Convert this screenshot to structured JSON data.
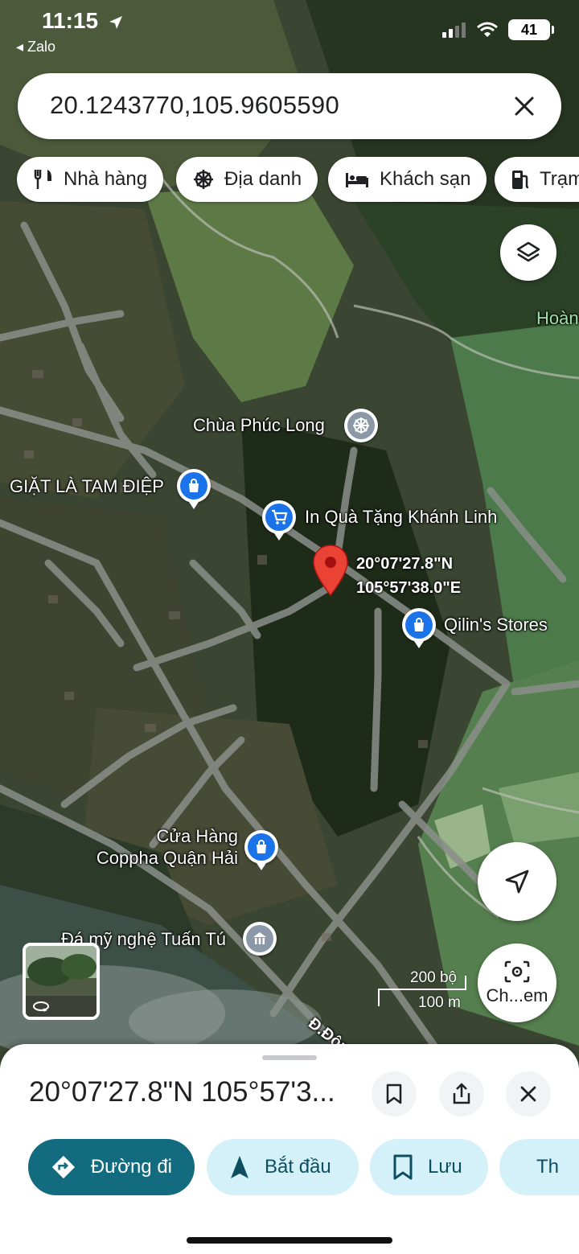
{
  "status_bar": {
    "time": "11:15",
    "back_app": "◂ Zalo",
    "battery": "41"
  },
  "search": {
    "value": "20.1243770,105.9605590"
  },
  "chips": [
    {
      "label": "Nhà hàng",
      "icon": "restaurant-icon"
    },
    {
      "label": "Địa danh",
      "icon": "landmark-icon"
    },
    {
      "label": "Khách sạn",
      "icon": "hotel-icon"
    },
    {
      "label": "Trạm",
      "icon": "gas-station-icon"
    }
  ],
  "map": {
    "area_label": "Hoàn",
    "street_label": "Đ.Đôn",
    "pin_coords_lat": "20°07'27.8\"N",
    "pin_coords_lng": "105°57'38.0\"E",
    "pois": [
      {
        "label": "Chùa Phúc Long",
        "icon": "temple-icon",
        "color": "#8a98a8"
      },
      {
        "label": "GIẶT LÀ TAM ĐIỆP",
        "icon": "shopping-bag-icon",
        "color": "#1a73e8"
      },
      {
        "label": "In Quà Tặng Khánh Linh",
        "icon": "shopping-cart-icon",
        "color": "#1a73e8"
      },
      {
        "label": "Qilin's Stores",
        "icon": "shopping-bag-icon",
        "color": "#1a73e8"
      },
      {
        "label": "Cửa Hàng\nCoppha Quận Hải",
        "label_line1": "Cửa Hàng",
        "label_line2": "Coppha Quận Hải",
        "icon": "shopping-bag-icon",
        "color": "#1a73e8"
      },
      {
        "label": "Đá mỹ nghệ Tuấn Tú",
        "icon": "museum-icon",
        "color": "#8a98a8"
      }
    ],
    "scale_imperial": "200 bộ",
    "scale_metric": "100 m",
    "lens_label": "Ch...em"
  },
  "sheet": {
    "title": "20°07'27.8\"N 105°57'3...",
    "actions": [
      {
        "label": "Đường đi",
        "icon": "directions-icon",
        "primary": true
      },
      {
        "label": "Bắt đầu",
        "icon": "navigation-arrow-icon"
      },
      {
        "label": "Lưu",
        "icon": "bookmark-icon"
      },
      {
        "label": "Th",
        "icon": "flag-icon"
      }
    ]
  },
  "colors": {
    "primary": "#126b7e",
    "action_bg": "#d4f1fa",
    "pin_red": "#ea4335",
    "poi_blue": "#1a73e8"
  }
}
